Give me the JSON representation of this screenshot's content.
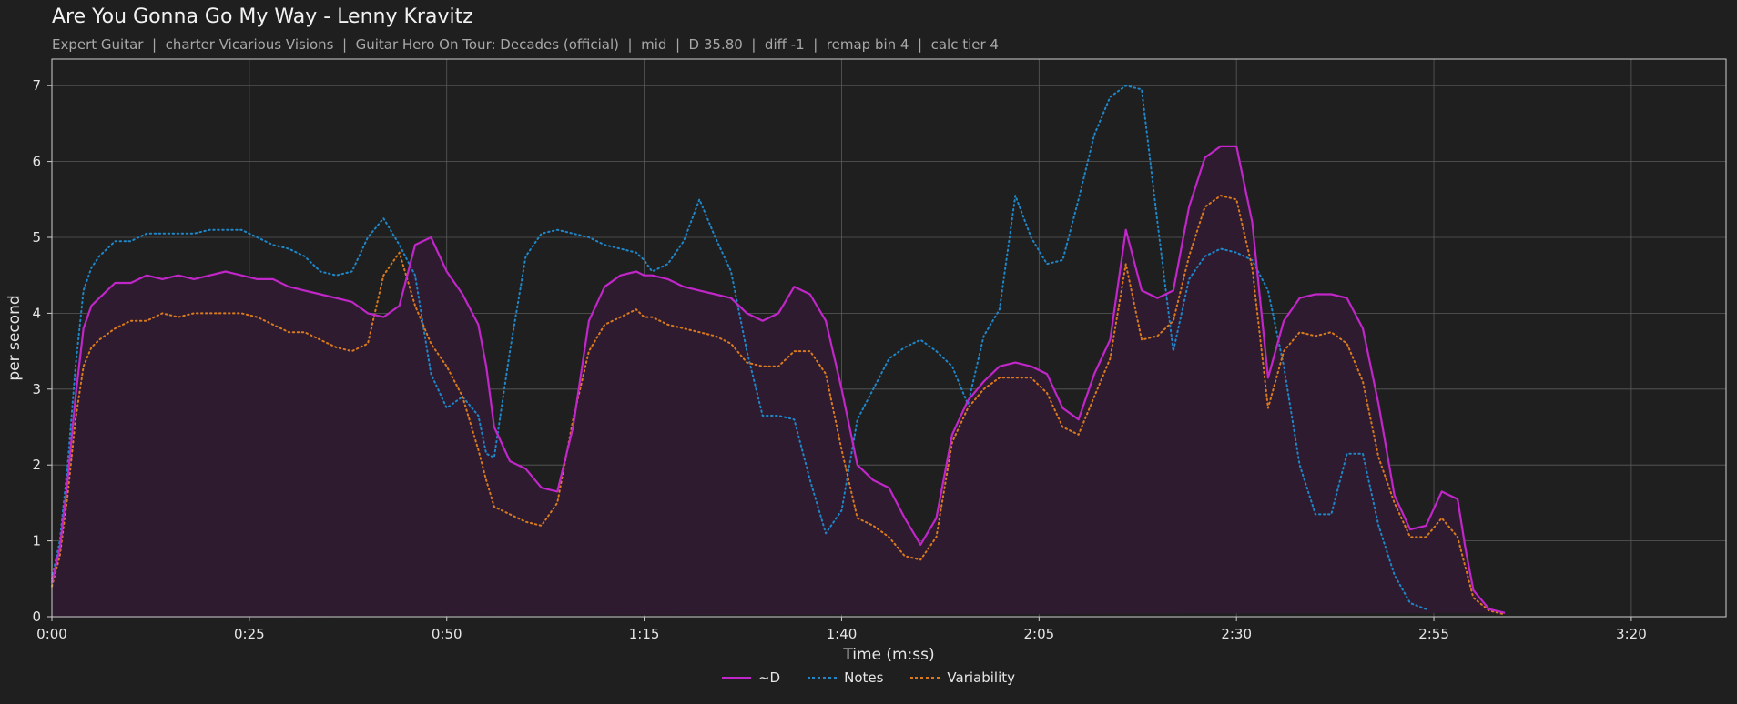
{
  "title": "Are You Gonna Go My Way - Lenny Kravitz",
  "subtitle": "Expert Guitar  |  charter Vicarious Visions  |  Guitar Hero On Tour: Decades (official)  |  mid  |  D 35.80  |  diff -1  |  remap bin 4  |  calc tier 4",
  "colors": {
    "background": "#1f1f1f",
    "d": "#c026c8",
    "notes": "#1f86c8",
    "variability": "#d97a1e",
    "fill": "#2e1b2f"
  },
  "chart_data": {
    "type": "line",
    "xlabel": "Time (m:ss)",
    "ylabel": "per second",
    "xlim": [
      0,
      212
    ],
    "ylim": [
      0,
      7.35
    ],
    "xticks": [
      0,
      25,
      50,
      75,
      100,
      125,
      150,
      175,
      200
    ],
    "xticklabels": [
      "0:00",
      "0:25",
      "0:50",
      "1:15",
      "1:40",
      "2:05",
      "2:30",
      "2:55",
      "3:20"
    ],
    "yticks": [
      0,
      1,
      2,
      3,
      4,
      5,
      6,
      7
    ],
    "yticklabels": [
      "0",
      "1",
      "2",
      "3",
      "4",
      "5",
      "6",
      "7"
    ],
    "grid": true,
    "legend_position": "bottom-center",
    "x": [
      0,
      1,
      2,
      3,
      4,
      5,
      6,
      8,
      10,
      12,
      14,
      16,
      18,
      20,
      22,
      24,
      26,
      28,
      30,
      32,
      34,
      36,
      38,
      40,
      42,
      44,
      46,
      48,
      50,
      52,
      54,
      55,
      56,
      58,
      60,
      62,
      64,
      66,
      68,
      70,
      72,
      74,
      75,
      76,
      78,
      80,
      82,
      84,
      86,
      88,
      90,
      92,
      94,
      96,
      98,
      100,
      102,
      104,
      106,
      108,
      110,
      112,
      114,
      116,
      118,
      120,
      122,
      124,
      126,
      128,
      130,
      132,
      134,
      136,
      138,
      140,
      142,
      144,
      146,
      148,
      150,
      152,
      154,
      156,
      158,
      160,
      162,
      164,
      166,
      168,
      170,
      172,
      174,
      176,
      178,
      179,
      180,
      182,
      184,
      186,
      188,
      190,
      192,
      194,
      196,
      198,
      200,
      202,
      204,
      206,
      208,
      210,
      212
    ],
    "series": [
      {
        "name": "~D",
        "style": "solid",
        "values": [
          0.45,
          0.9,
          1.8,
          2.9,
          3.8,
          4.1,
          4.2,
          4.4,
          4.4,
          4.5,
          4.45,
          4.5,
          4.45,
          4.5,
          4.55,
          4.5,
          4.45,
          4.45,
          4.35,
          4.3,
          4.25,
          4.2,
          4.15,
          4.0,
          3.95,
          4.1,
          4.9,
          5.0,
          4.55,
          4.25,
          3.85,
          3.3,
          2.5,
          2.05,
          1.95,
          1.7,
          1.65,
          2.5,
          3.9,
          4.35,
          4.5,
          4.55,
          4.5,
          4.5,
          4.45,
          4.35,
          4.3,
          4.25,
          4.2,
          4.0,
          3.9,
          4.0,
          4.35,
          4.25,
          3.9,
          3.0,
          2.0,
          1.8,
          1.7,
          1.3,
          0.95,
          1.3,
          2.4,
          2.85,
          3.1,
          3.3,
          3.35,
          3.3,
          3.2,
          2.75,
          2.6,
          3.2,
          3.65,
          5.1,
          4.3,
          4.2,
          4.3,
          5.4,
          6.05,
          6.2,
          6.2,
          5.2,
          3.15,
          3.9,
          4.2,
          4.25,
          4.25,
          4.2,
          3.8,
          2.8,
          1.6,
          1.15,
          1.2,
          1.65,
          1.55,
          0.9,
          0.35,
          0.1,
          0.05
        ]
      },
      {
        "name": "Notes",
        "style": "dotted",
        "values": [
          0.5,
          1.0,
          2.0,
          3.3,
          4.3,
          4.6,
          4.75,
          4.95,
          4.95,
          5.05,
          5.05,
          5.05,
          5.05,
          5.1,
          5.1,
          5.1,
          5.0,
          4.9,
          4.85,
          4.75,
          4.55,
          4.5,
          4.55,
          5.0,
          5.25,
          4.9,
          4.5,
          3.2,
          2.75,
          2.9,
          2.65,
          2.15,
          2.1,
          3.5,
          4.75,
          5.05,
          5.1,
          5.05,
          5.0,
          4.9,
          4.85,
          4.8,
          4.7,
          4.55,
          4.65,
          4.95,
          5.5,
          5.0,
          4.55,
          3.5,
          2.65,
          2.65,
          2.6,
          1.8,
          1.1,
          1.4,
          2.6,
          3.0,
          3.4,
          3.55,
          3.65,
          3.5,
          3.3,
          2.8,
          3.7,
          4.05,
          5.55,
          5.0,
          4.65,
          4.7,
          5.5,
          6.35,
          6.85,
          7.0,
          6.95,
          5.2,
          3.5,
          4.45,
          4.75,
          4.85,
          4.8,
          4.7,
          4.3,
          3.3,
          2.0,
          1.35,
          1.35,
          2.15,
          2.15,
          1.2,
          0.55,
          0.18,
          0.1
        ]
      },
      {
        "name": "Variability",
        "style": "dotted",
        "values": [
          0.4,
          0.8,
          1.6,
          2.6,
          3.3,
          3.55,
          3.65,
          3.8,
          3.9,
          3.9,
          4.0,
          3.95,
          4.0,
          4.0,
          4.0,
          4.0,
          3.95,
          3.85,
          3.75,
          3.75,
          3.65,
          3.55,
          3.5,
          3.6,
          4.5,
          4.8,
          4.1,
          3.6,
          3.3,
          2.9,
          2.2,
          1.8,
          1.45,
          1.35,
          1.25,
          1.2,
          1.5,
          2.6,
          3.5,
          3.85,
          3.95,
          4.05,
          3.95,
          3.95,
          3.85,
          3.8,
          3.75,
          3.7,
          3.6,
          3.35,
          3.3,
          3.3,
          3.5,
          3.5,
          3.2,
          2.2,
          1.3,
          1.2,
          1.05,
          0.8,
          0.75,
          1.05,
          2.3,
          2.75,
          3.0,
          3.15,
          3.15,
          3.15,
          2.95,
          2.5,
          2.4,
          2.9,
          3.4,
          4.65,
          3.65,
          3.7,
          3.9,
          4.75,
          5.4,
          5.55,
          5.5,
          4.6,
          2.75,
          3.5,
          3.75,
          3.7,
          3.75,
          3.6,
          3.1,
          2.1,
          1.5,
          1.05,
          1.05,
          1.3,
          1.05,
          0.65,
          0.25,
          0.08,
          0.03
        ]
      }
    ]
  }
}
